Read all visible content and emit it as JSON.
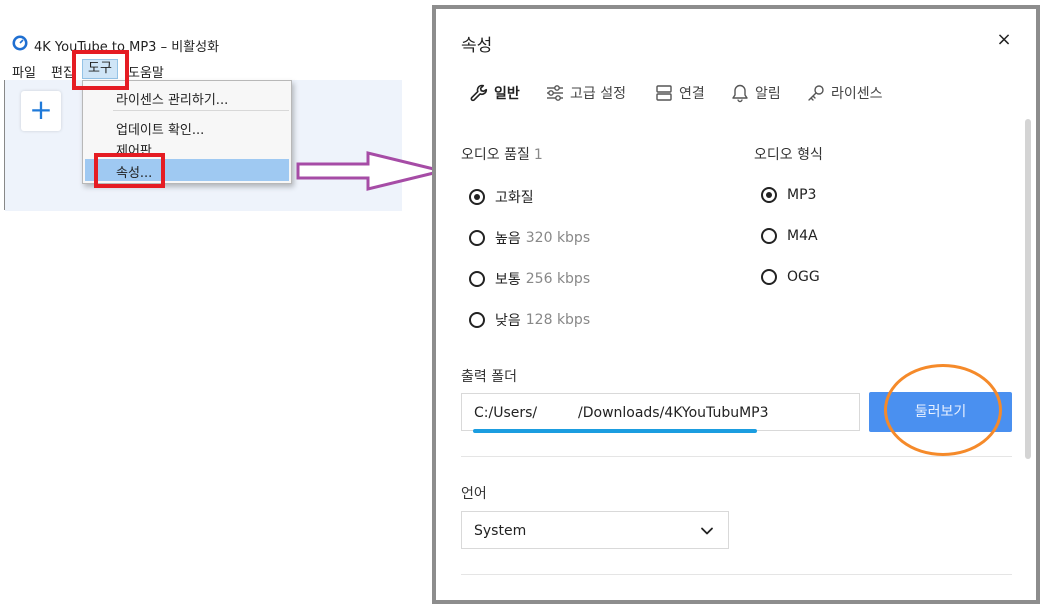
{
  "app": {
    "title": "4K YouTube to MP3 – 비활성화",
    "menu": [
      "파일",
      "편집",
      "도구",
      "도움말"
    ],
    "dropdown": {
      "license": "라이센스 관리하기...",
      "update": "업데이트 확인...",
      "control_panel": "제어판...",
      "properties": "속성..."
    },
    "add_button": "+"
  },
  "dialog": {
    "title": "속성",
    "close": "×",
    "tabs": [
      "일반",
      "고급 설정",
      "연결",
      "알림",
      "라이센스"
    ],
    "audio_quality": {
      "label": "오디오 품질",
      "info": "1",
      "options": [
        {
          "label": "고화질",
          "detail": "",
          "checked": true
        },
        {
          "label": "높음",
          "detail": "320 kbps",
          "checked": false
        },
        {
          "label": "보통",
          "detail": "256 kbps",
          "checked": false
        },
        {
          "label": "낮음",
          "detail": "128 kbps",
          "checked": false
        }
      ]
    },
    "audio_format": {
      "label": "오디오 형식",
      "options": [
        {
          "label": "MP3",
          "checked": true
        },
        {
          "label": "M4A",
          "checked": false
        },
        {
          "label": "OGG",
          "checked": false
        }
      ]
    },
    "output_folder": {
      "label": "출력 폴더",
      "value_start": "C:/Users/",
      "value_end": "/Downloads/4KYouTubuMP3",
      "browse": "둘러보기"
    },
    "language": {
      "label": "언어",
      "value": "System"
    }
  },
  "colors": {
    "highlight_red": "#e51c23",
    "arrow_purple": "#a64ca6",
    "circle_orange": "#f58a2a",
    "accent_blue": "#4a90f0"
  }
}
